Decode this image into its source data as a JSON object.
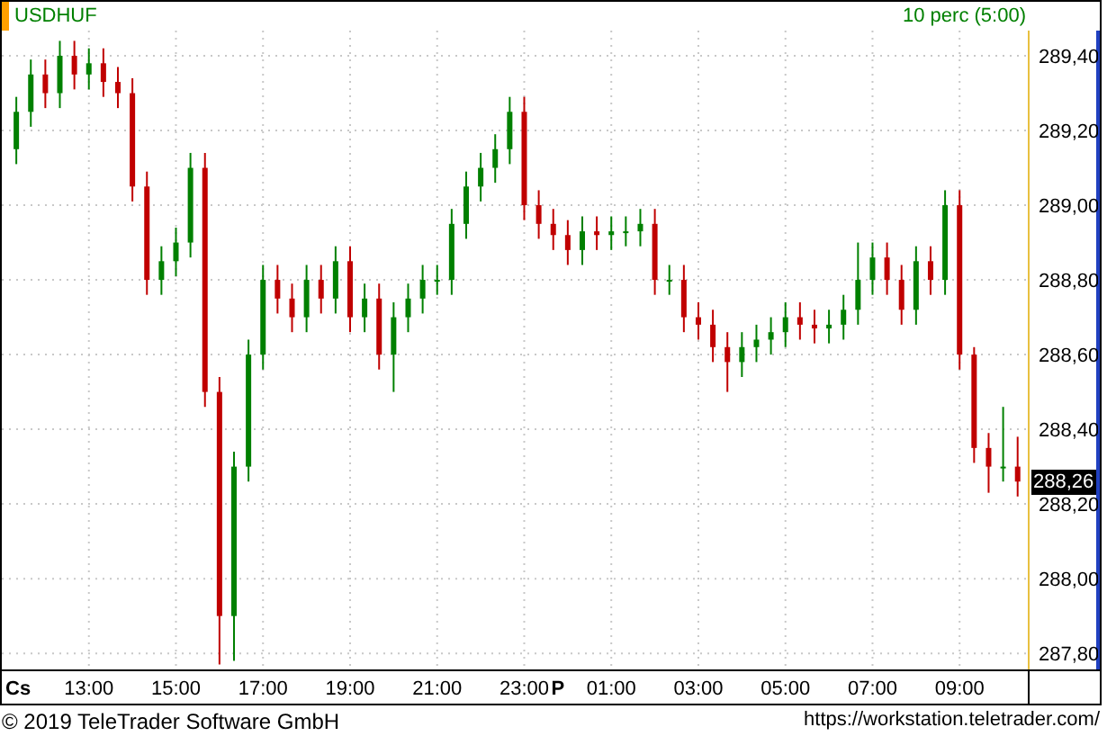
{
  "header": {
    "symbol": "USDHUF",
    "interval": "10 perc (5:00)"
  },
  "chart": {
    "last_price": "288,26",
    "day_labels": [
      {
        "label": "Cs",
        "kind": "start"
      },
      {
        "label": "P",
        "kind": "midnight"
      }
    ],
    "chart_data": {
      "type": "candlestick",
      "grid": true,
      "ylim": [
        287.757,
        289.4675
      ],
      "yticks": [
        {
          "value": 289.4,
          "label": "289,40"
        },
        {
          "value": 289.2,
          "label": "289,20"
        },
        {
          "value": 289.0,
          "label": "289,00"
        },
        {
          "value": 288.8,
          "label": "288,80"
        },
        {
          "value": 288.6,
          "label": "288,60"
        },
        {
          "value": 288.4,
          "label": "288,40"
        },
        {
          "value": 288.2,
          "label": "288,20"
        },
        {
          "value": 288.0,
          "label": "288,00"
        },
        {
          "value": 287.8,
          "label": "287,80"
        }
      ],
      "categories": [
        null,
        null,
        null,
        null,
        null,
        "13:00",
        null,
        null,
        null,
        null,
        null,
        "15:00",
        null,
        null,
        null,
        null,
        null,
        "17:00",
        null,
        null,
        null,
        null,
        null,
        "19:00",
        null,
        null,
        null,
        null,
        null,
        "21:00",
        null,
        null,
        null,
        null,
        null,
        "23:00",
        null,
        null,
        null,
        null,
        null,
        "01:00",
        null,
        null,
        null,
        null,
        null,
        "03:00",
        null,
        null,
        null,
        null,
        null,
        "05:00",
        null,
        null,
        null,
        null,
        null,
        "07:00",
        null,
        null,
        null,
        null,
        null,
        "09:00",
        null,
        null,
        null,
        null
      ],
      "ohlc": [
        [
          289.15,
          289.29,
          289.11,
          289.25
        ],
        [
          289.25,
          289.39,
          289.21,
          289.35
        ],
        [
          289.35,
          289.39,
          289.26,
          289.3
        ],
        [
          289.3,
          289.44,
          289.26,
          289.4
        ],
        [
          289.4,
          289.44,
          289.31,
          289.35
        ],
        [
          289.35,
          289.42,
          289.31,
          289.38
        ],
        [
          289.38,
          289.42,
          289.29,
          289.33
        ],
        [
          289.33,
          289.37,
          289.26,
          289.3
        ],
        [
          289.3,
          289.34,
          289.01,
          289.05
        ],
        [
          289.05,
          289.09,
          288.76,
          288.8
        ],
        [
          288.8,
          288.89,
          288.76,
          288.85
        ],
        [
          288.85,
          288.94,
          288.81,
          288.9
        ],
        [
          288.9,
          289.14,
          288.86,
          289.1
        ],
        [
          289.1,
          289.14,
          288.46,
          288.5
        ],
        [
          288.5,
          288.54,
          287.77,
          287.9
        ],
        [
          287.9,
          288.34,
          287.78,
          288.3
        ],
        [
          288.3,
          288.64,
          288.26,
          288.6
        ],
        [
          288.6,
          288.84,
          288.56,
          288.8
        ],
        [
          288.8,
          288.84,
          288.71,
          288.75
        ],
        [
          288.75,
          288.79,
          288.66,
          288.7
        ],
        [
          288.7,
          288.84,
          288.66,
          288.8
        ],
        [
          288.8,
          288.84,
          288.71,
          288.75
        ],
        [
          288.75,
          288.89,
          288.71,
          288.85
        ],
        [
          288.85,
          288.89,
          288.66,
          288.7
        ],
        [
          288.7,
          288.79,
          288.66,
          288.75
        ],
        [
          288.75,
          288.79,
          288.56,
          288.6
        ],
        [
          288.6,
          288.74,
          288.5,
          288.7
        ],
        [
          288.7,
          288.79,
          288.66,
          288.75
        ],
        [
          288.75,
          288.84,
          288.71,
          288.8
        ],
        [
          288.8,
          288.84,
          288.76,
          288.8
        ],
        [
          288.8,
          288.99,
          288.76,
          288.95
        ],
        [
          288.95,
          289.09,
          288.91,
          289.05
        ],
        [
          289.05,
          289.14,
          289.01,
          289.1
        ],
        [
          289.1,
          289.19,
          289.06,
          289.15
        ],
        [
          289.15,
          289.29,
          289.11,
          289.25
        ],
        [
          289.25,
          289.29,
          288.96,
          289.0
        ],
        [
          289.0,
          289.04,
          288.91,
          288.95
        ],
        [
          288.95,
          288.99,
          288.88,
          288.92
        ],
        [
          288.92,
          288.96,
          288.84,
          288.88
        ],
        [
          288.88,
          288.97,
          288.84,
          288.93
        ],
        [
          288.93,
          288.97,
          288.88,
          288.92
        ],
        [
          288.92,
          288.97,
          288.88,
          288.93
        ],
        [
          288.93,
          288.97,
          288.89,
          288.93
        ],
        [
          288.93,
          288.99,
          288.89,
          288.95
        ],
        [
          288.95,
          288.99,
          288.76,
          288.8
        ],
        [
          288.8,
          288.84,
          288.76,
          288.8
        ],
        [
          288.8,
          288.84,
          288.66,
          288.7
        ],
        [
          288.7,
          288.74,
          288.64,
          288.68
        ],
        [
          288.68,
          288.72,
          288.58,
          288.62
        ],
        [
          288.62,
          288.66,
          288.5,
          288.58
        ],
        [
          288.58,
          288.66,
          288.54,
          288.62
        ],
        [
          288.62,
          288.68,
          288.58,
          288.64
        ],
        [
          288.64,
          288.7,
          288.6,
          288.66
        ],
        [
          288.66,
          288.74,
          288.62,
          288.7
        ],
        [
          288.7,
          288.74,
          288.64,
          288.68
        ],
        [
          288.68,
          288.72,
          288.63,
          288.67
        ],
        [
          288.67,
          288.72,
          288.63,
          288.68
        ],
        [
          288.68,
          288.76,
          288.64,
          288.72
        ],
        [
          288.72,
          288.9,
          288.68,
          288.8
        ],
        [
          288.8,
          288.9,
          288.76,
          288.86
        ],
        [
          288.86,
          288.9,
          288.76,
          288.8
        ],
        [
          288.8,
          288.84,
          288.68,
          288.72
        ],
        [
          288.72,
          288.89,
          288.68,
          288.85
        ],
        [
          288.85,
          288.89,
          288.76,
          288.8
        ],
        [
          288.8,
          289.04,
          288.76,
          289.0
        ],
        [
          289.0,
          289.04,
          288.56,
          288.6
        ],
        [
          288.6,
          288.62,
          288.31,
          288.35
        ],
        [
          288.35,
          288.39,
          288.23,
          288.3
        ],
        [
          288.3,
          288.46,
          288.26,
          288.3
        ],
        [
          288.3,
          288.38,
          288.22,
          288.26
        ]
      ]
    }
  },
  "footer": {
    "copyright": "© 2019 TeleTrader Software GmbH",
    "url": "https://workstation.teletrader.com/"
  }
}
